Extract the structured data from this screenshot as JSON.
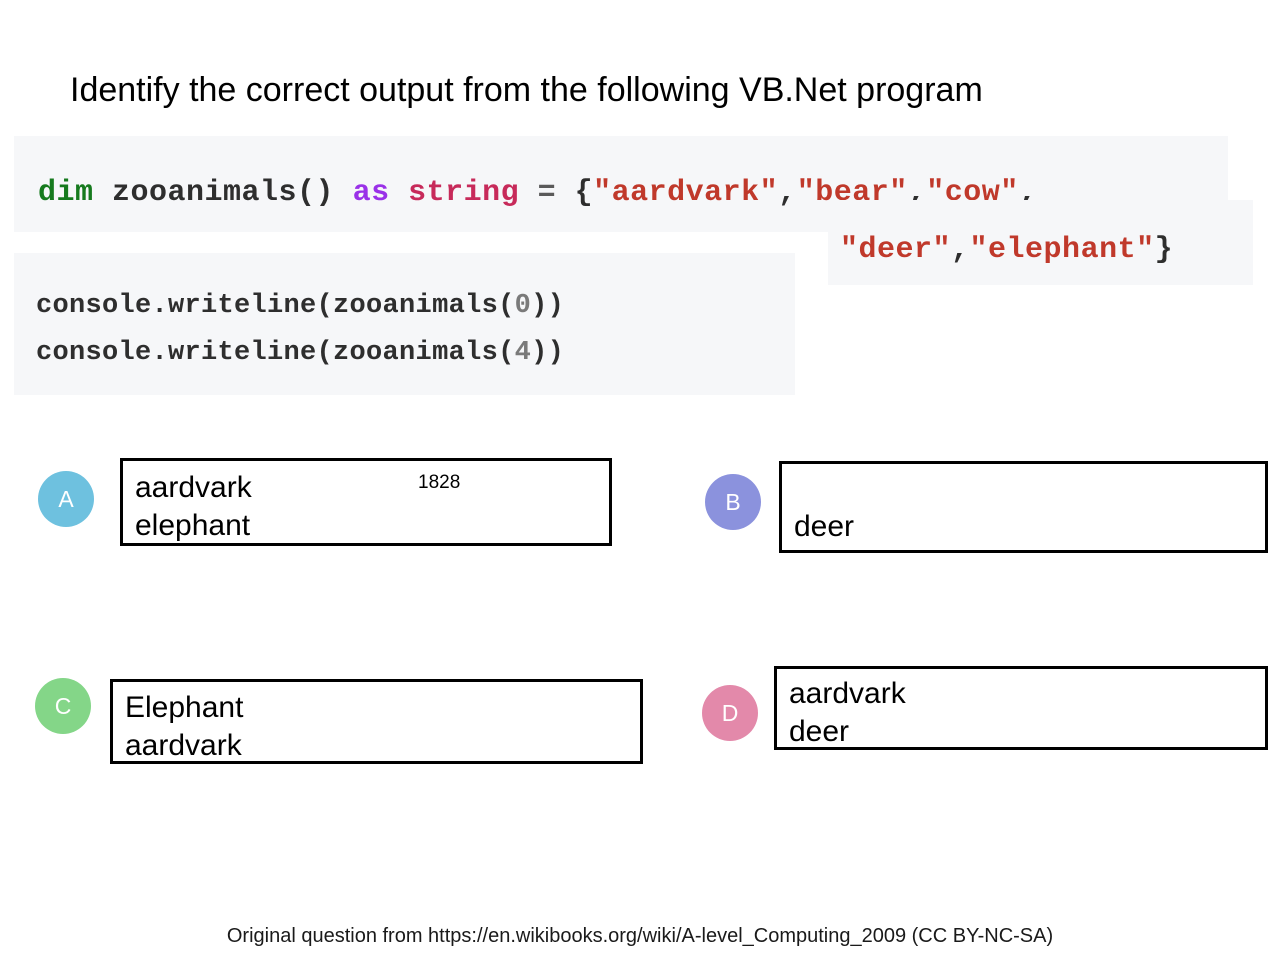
{
  "slide": {
    "title": "Identify the correct output from the following VB.Net program",
    "footer": "Original question from https://en.wikibooks.org/wiki/A-level_Computing_2009 (CC BY-NC-SA)"
  },
  "code": {
    "declaration": {
      "keyword": "dim",
      "identifier": " zooanimals() ",
      "as": "as",
      "type": " string",
      "operator": " = ",
      "open_brace": "{",
      "str_aardvark": "\"aardvark\"",
      "comma1": ",",
      "str_bear": "\"bear\"",
      "comma2": ",",
      "str_cow": "\"cow\"",
      "comma3": ","
    },
    "continuation": {
      "str_deer": "\"deer\"",
      "comma1": ",",
      "str_elephant": "\"elephant\"",
      "close_brace": "}"
    },
    "output_lines": {
      "line1_prefix": "console.writeline(zooanimals(",
      "line1_index": "0",
      "line1_suffix": "))",
      "line2_prefix": "console.writeline(zooanimals(",
      "line2_index": "4",
      "line2_suffix": "))"
    }
  },
  "options": {
    "a": {
      "letter": "A",
      "line1": "aardvark",
      "line2": "elephant",
      "note": "1828",
      "color": "#6ec1df"
    },
    "b": {
      "letter": "B",
      "line1": "deer",
      "color": "#8b92dd"
    },
    "c": {
      "letter": "C",
      "line1": "Elephant",
      "line2": "aardvark",
      "color": "#84d688"
    },
    "d": {
      "letter": "D",
      "line1": "aardvark",
      "line2": "deer",
      "color": "#e389aa"
    }
  }
}
